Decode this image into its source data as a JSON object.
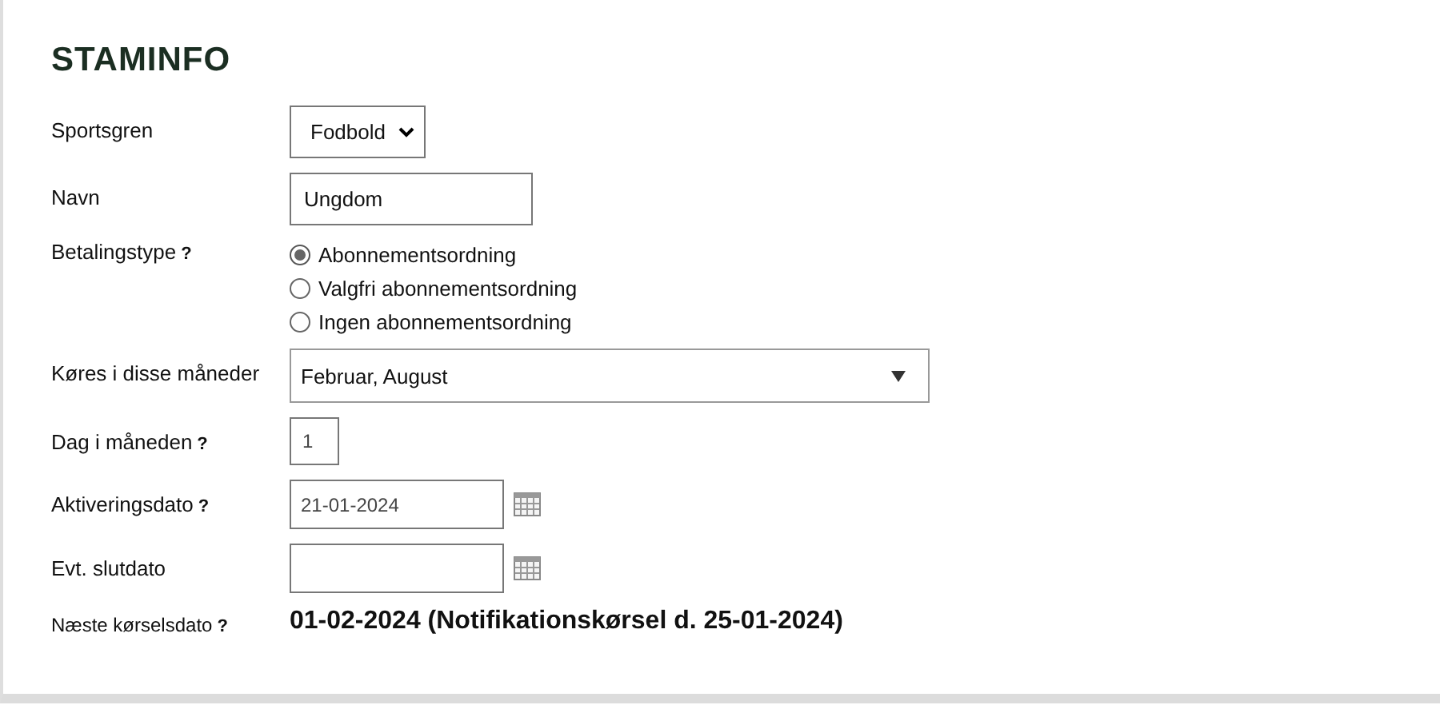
{
  "section": {
    "title": "STAMINFO"
  },
  "fields": [
    {
      "kind": "select",
      "label": "Sportsgren",
      "value": "Fodbold"
    },
    {
      "kind": "text",
      "label": "Navn",
      "value": "Ungdom"
    },
    {
      "kind": "radio",
      "label": "Betalingstype",
      "help": "?",
      "options": [
        {
          "label": "Abonnementsordning",
          "selected": true
        },
        {
          "label": "Valgfri abonnementsordning",
          "selected": false
        },
        {
          "label": "Ingen abonnementsordning",
          "selected": false
        }
      ]
    },
    {
      "kind": "multiselect",
      "label": "Køres i disse måneder",
      "value": "Februar, August"
    },
    {
      "kind": "number",
      "label": "Dag i måneden",
      "help": "?",
      "value": "1"
    },
    {
      "kind": "date",
      "label": "Aktiveringsdato",
      "help": "?",
      "value": "21-01-2024"
    },
    {
      "kind": "date",
      "label": "Evt. slutdato"
    },
    {
      "kind": "readout",
      "label": "Næste kørselsdato",
      "help": "?",
      "value": "01-02-2024 (Notifikationskørsel d. 25-01-2024)"
    }
  ]
}
